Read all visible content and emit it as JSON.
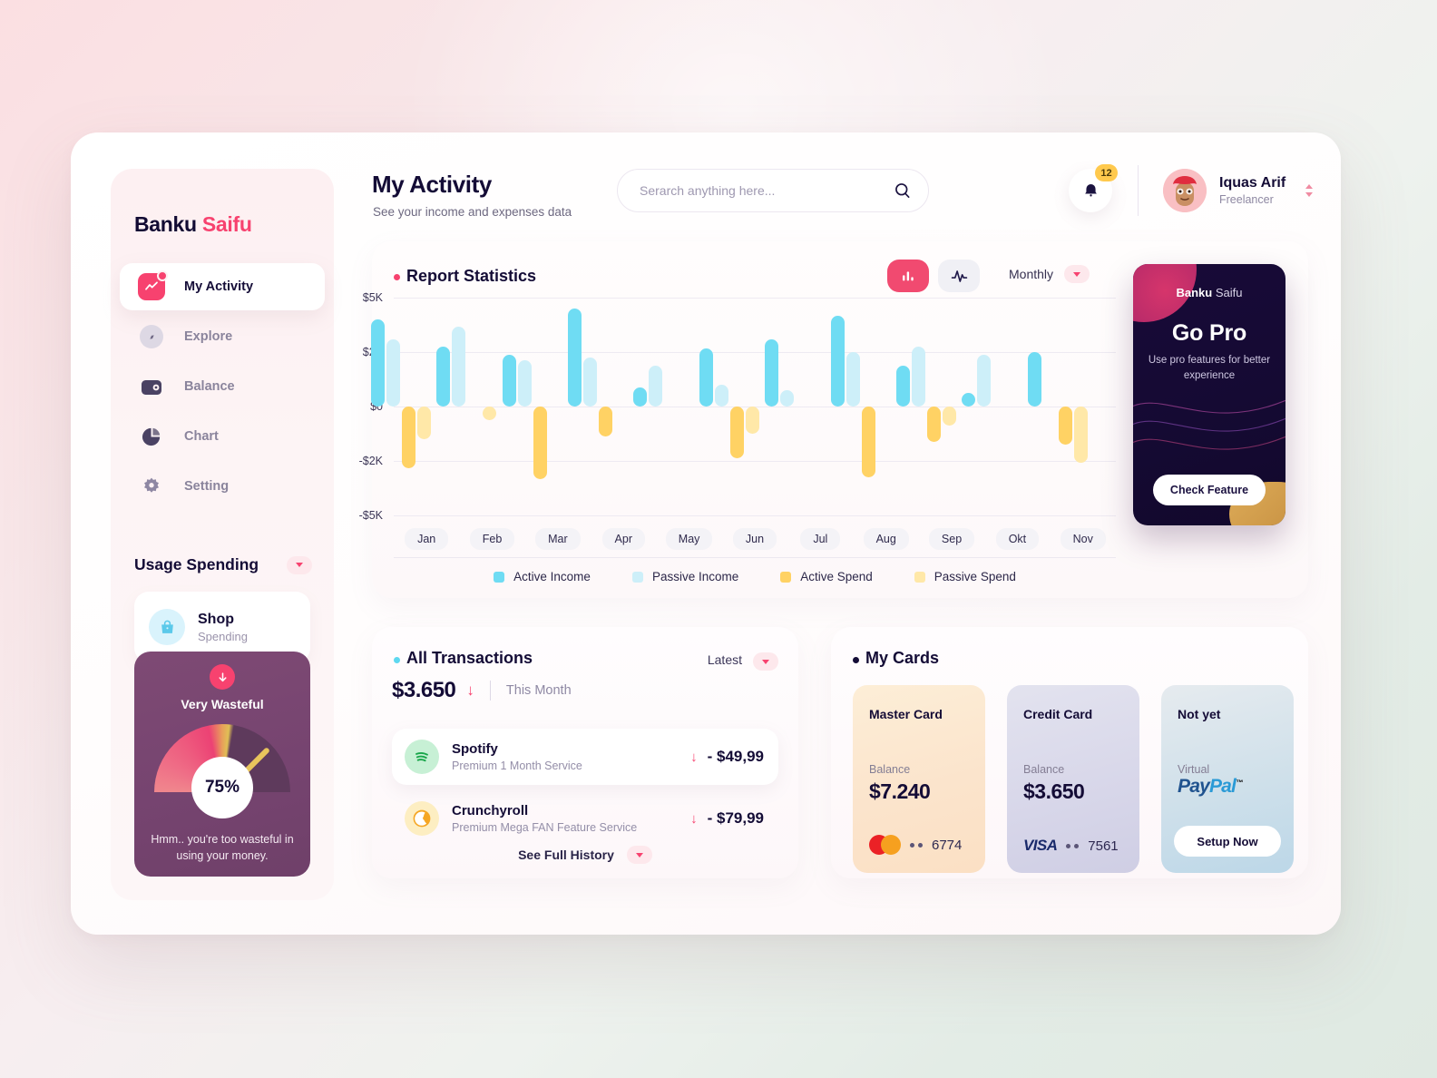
{
  "brand": {
    "first": "Banku",
    "second": "Saifu"
  },
  "sidebar": {
    "items": [
      {
        "label": "My Activity",
        "icon": "activity-icon"
      },
      {
        "label": "Explore",
        "icon": "compass-icon"
      },
      {
        "label": "Balance",
        "icon": "wallet-icon"
      },
      {
        "label": "Chart",
        "icon": "pie-chart-icon"
      },
      {
        "label": "Setting",
        "icon": "gear-icon"
      }
    ],
    "usage": {
      "title": "Usage Spending",
      "shop_name": "Shop",
      "shop_sub": "Spending",
      "status": "Very Wasteful",
      "percent": "75%",
      "note": "Hmm.. you're too wasteful in using your money."
    }
  },
  "header": {
    "title": "My Activity",
    "subtitle": "See your income and expenses data",
    "search_placeholder": "Serarch anything here...",
    "search_value": "",
    "notification_count": "12",
    "user_name": "Iquas Arif",
    "user_role": "Freelancer"
  },
  "report": {
    "title": "Report Statistics",
    "period": "Monthly",
    "view_bar": "bar-chart-icon",
    "view_line": "line-chart-icon"
  },
  "chart_data": {
    "type": "bar",
    "title": "Report Statistics",
    "xlabel": "",
    "ylabel": "",
    "ylim": [
      -5000,
      5000
    ],
    "ytick_labels": [
      "$5K",
      "$2K",
      "$0",
      "-$2K",
      "-$5K"
    ],
    "ytick_values": [
      5000,
      2000,
      0,
      -2000,
      -5000
    ],
    "grid": true,
    "legend_position": "bottom",
    "categories": [
      "Jan",
      "Feb",
      "Mar",
      "Apr",
      "May",
      "Jun",
      "Jul",
      "Aug",
      "Sep",
      "Okt",
      "Nov"
    ],
    "series": [
      {
        "name": "Active Income",
        "color": "#6fdcf3",
        "values": [
          3800,
          2300,
          1900,
          4400,
          700,
          2200,
          2700,
          4000,
          1500,
          500,
          2000
        ]
      },
      {
        "name": "Passive Income",
        "color": "#cdeff9",
        "values": [
          2700,
          3400,
          1700,
          1800,
          1500,
          800,
          600,
          2000,
          2300,
          1900,
          0
        ]
      },
      {
        "name": "Active Spend",
        "color": "#ffd264",
        "values": [
          -2400,
          0,
          -3000,
          -1100,
          0,
          -1900,
          0,
          -2900,
          -1300,
          0,
          -1400
        ]
      },
      {
        "name": "Passive Spend",
        "color": "#ffe8a8",
        "values": [
          -1200,
          -500,
          0,
          0,
          0,
          -1000,
          0,
          0,
          -700,
          0,
          -2100
        ]
      }
    ]
  },
  "promo": {
    "brand_first": "Banku",
    "brand_second": "Saifu",
    "heading": "Go Pro",
    "text": "Use pro features for better experience",
    "button": "Check Feature"
  },
  "transactions": {
    "title": "All Transactions",
    "sort": "Latest",
    "amount": "$3.650",
    "period": "This Month",
    "items": [
      {
        "name": "Spotify",
        "desc": "Premium 1 Month Service",
        "amount": "- $49,99",
        "icon": "spotify-icon"
      },
      {
        "name": "Crunchyroll",
        "desc": "Premium Mega FAN Feature Service",
        "amount": "- $79,99",
        "icon": "crunchyroll-icon"
      }
    ],
    "see_full": "See Full History"
  },
  "cards": {
    "title": "My Cards",
    "items": [
      {
        "name": "Master Card",
        "label": "Balance",
        "amount": "$7.240",
        "number": "6774",
        "brand": "mastercard-logo",
        "action": ""
      },
      {
        "name": "Credit Card",
        "label": "Balance",
        "amount": "$3.650",
        "number": "7561",
        "brand": "visa-logo",
        "action": ""
      },
      {
        "name": "Not yet",
        "label": "Virtual",
        "amount": "",
        "number": "",
        "brand": "paypal-logo",
        "action": "Setup Now"
      }
    ]
  }
}
